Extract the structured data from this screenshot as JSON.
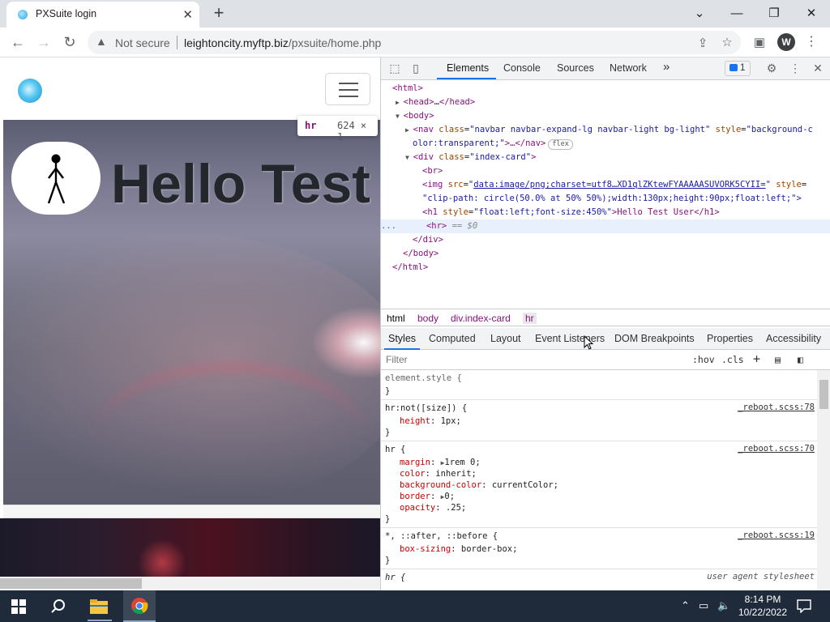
{
  "browser": {
    "tab_title": "PXSuite login",
    "tab_close": "✕",
    "new_tab": "+",
    "window_controls": {
      "minimize": "⌄",
      "min": "—",
      "restore": "❐",
      "close": "✕"
    },
    "security_label": "Not secure",
    "url_domain": "leightoncity.myftp.biz",
    "url_path": "/pxsuite/home.php",
    "profile_initial": "W"
  },
  "page": {
    "heading": "Hello Test",
    "tooltip_tag": "hr",
    "tooltip_size": "624 × 1"
  },
  "devtools": {
    "tabs": [
      "Elements",
      "Console",
      "Sources",
      "Network"
    ],
    "more": "»",
    "issues_count": "1",
    "dom": {
      "l1": "<html>",
      "l2_open": "<head>",
      "l2_mid": "…",
      "l2_close": "</head>",
      "l3": "<body>",
      "nav_tag": "<nav",
      "nav_attr1": "class",
      "nav_val1": "\"navbar navbar-expand-lg navbar-light bg-light\"",
      "nav_attr2": "style",
      "nav_val2a": "\"background-c",
      "nav_val2b": "olor:transparent;\"",
      "nav_end": ">…</nav>",
      "flex_badge": "flex",
      "div_tag": "<div",
      "div_attr": "class",
      "div_val": "\"index-card\"",
      "br": "<br>",
      "img_tag": "<img",
      "img_attr1": "src",
      "img_link": "data:image/png;charset=utf8…XD1qlZKtewFYAAAAASUVORK5CYII=",
      "img_attr2": "style",
      "img_val2a": "\"",
      "img_val2b": "\"clip-path: circle(50.0% at 50% 50%);width:130px;height:90px;float:left;\">",
      "h1_tag": "<h1",
      "h1_attr": "style",
      "h1_val": "\"float:left;font-size:450%\"",
      "h1_text": ">Hello Test User</h1>",
      "hr_tag": "<hr>",
      "hr_eq": "== $0",
      "div_close": "</div>",
      "body_close": "</body>",
      "html_close": "</html>",
      "ellipsis": "..."
    },
    "breadcrumbs": [
      "html",
      "body",
      "div.index-card",
      "hr"
    ],
    "subtabs": [
      "Styles",
      "Computed",
      "Layout",
      "Event Listeners",
      "DOM Breakpoints",
      "Properties",
      "Accessibility"
    ],
    "filter_placeholder": "Filter",
    "hov": ":hov",
    "cls": ".cls",
    "rules": {
      "r1_sel": "element.style {",
      "close": "}",
      "r2_sel": "hr:not([size]) {",
      "r2_src": "_reboot.scss:78",
      "r2_p1n": "height",
      "r2_p1v": "1px;",
      "r3_sel": "hr {",
      "r3_src": "_reboot.scss:70",
      "r3_margin_n": "margin",
      "r3_margin_v": "1rem 0;",
      "r3_color_n": "color",
      "r3_color_v": "inherit;",
      "r3_bg_n": "background-color",
      "r3_bg_v": "currentColor;",
      "r3_border_n": "border",
      "r3_border_v": "0;",
      "r3_op_n": "opacity",
      "r3_op_v": ".25;",
      "r4_sel": "*, ::after, ::before {",
      "r4_src": "_reboot.scss:19",
      "r4_bs_n": "box-sizing",
      "r4_bs_v": "border-box;",
      "r5_sel": "hr {",
      "r5_src": "user agent stylesheet"
    }
  },
  "taskbar": {
    "time": "8:14 PM",
    "date": "10/22/2022"
  }
}
